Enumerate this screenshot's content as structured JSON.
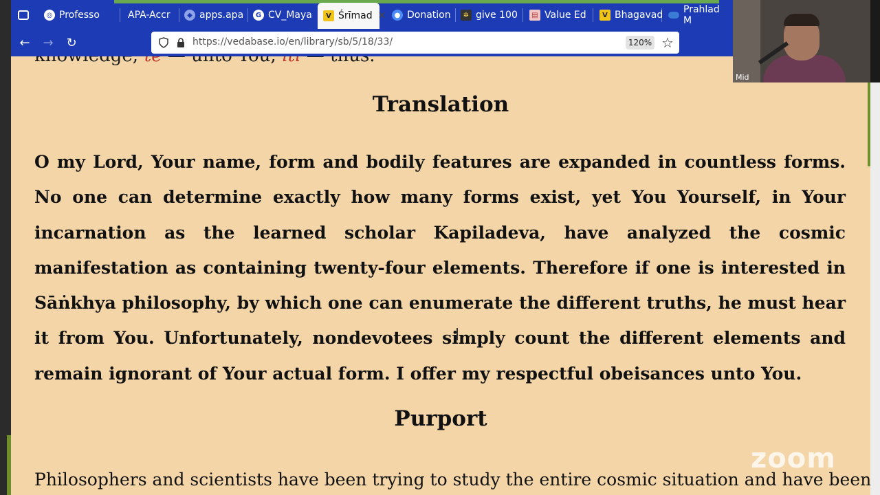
{
  "browser": {
    "tabs": [
      {
        "label": "Professo",
        "icon": "globe-icon"
      },
      {
        "label": "APA-Accr",
        "icon": "apa-icon"
      },
      {
        "label": "apps.apa",
        "icon": "apps-icon"
      },
      {
        "label": "CV_Maya",
        "icon": "chrome-icon"
      },
      {
        "label": "Śrīmad",
        "icon": "vedabase-icon",
        "active": true
      },
      {
        "label": "Donation",
        "icon": "donation-icon"
      },
      {
        "label": "give 100",
        "icon": "give-icon"
      },
      {
        "label": "Value Ed",
        "icon": "value-ed-icon"
      },
      {
        "label": "Bhagavad",
        "icon": "vedabase-icon"
      },
      {
        "label": "Prahlad M",
        "icon": "cloud-icon"
      }
    ],
    "url": "https://vedabase.io/en/library/sb/5/18/33/",
    "zoom": "120%"
  },
  "page": {
    "partial_line": {
      "prefix": "knowledge;",
      "word1": "te",
      "mid": "— unto You;",
      "word2": "iti",
      "suffix": "— thus."
    },
    "translation_heading": "Translation",
    "translation_text": "O my Lord, Your name, form and bodily features are expanded in countless forms. No one can determine exactly how many forms exist, yet You Yourself, in Your incarnation as the learned scholar Kapiladeva, have analyzed the cosmic manifestation as containing twenty-four elements. Therefore if one is interested in Sāṅkhya philosophy, by which one can enumerate the different truths, he must hear it from You. Unfortunately, nondevotees simply count the different elements and remain ignorant of Your actual form. I offer my respectful obeisances unto You.",
    "purport_heading": "Purport",
    "purport_text": "Philosophers and scientists have been trying to study the entire cosmic situation and have been"
  },
  "overlay": {
    "zoom_watermark": "zoom",
    "video_label": "Mid"
  },
  "colors": {
    "page_bg": "#f3d5a8",
    "browser_chrome": "#1d3bb5",
    "accent_red": "#c0392b",
    "accent_green": "#6e8f2b"
  }
}
